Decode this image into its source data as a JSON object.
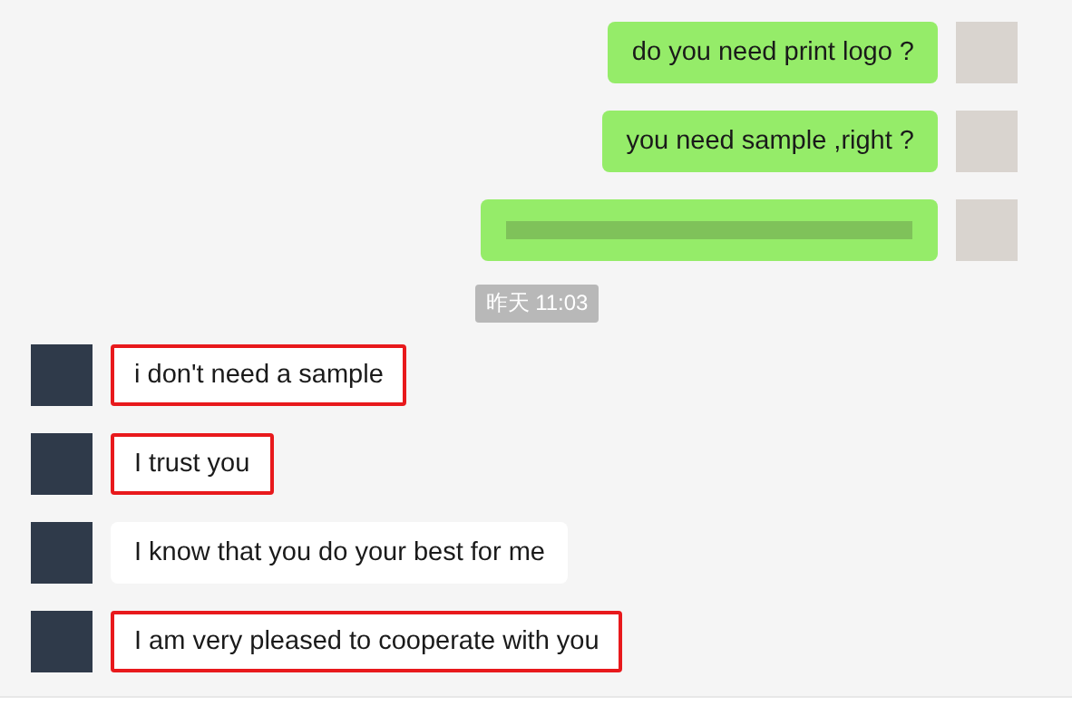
{
  "messages": [
    {
      "kind": "outgoing",
      "text": "do you need print logo ?",
      "highlighted": false
    },
    {
      "kind": "outgoing",
      "text": "you need sample ,right ?",
      "highlighted": false
    },
    {
      "kind": "outgoing_blurred",
      "highlighted": false
    },
    {
      "kind": "time",
      "text": "昨天 11:03"
    },
    {
      "kind": "incoming",
      "text": "i don't need a sample",
      "highlighted": true
    },
    {
      "kind": "incoming",
      "text": "I trust you",
      "highlighted": true
    },
    {
      "kind": "incoming",
      "text": "I know that you do your best for me",
      "highlighted": false
    },
    {
      "kind": "incoming",
      "text": "I am very pleased to cooperate with you",
      "highlighted": true
    }
  ]
}
